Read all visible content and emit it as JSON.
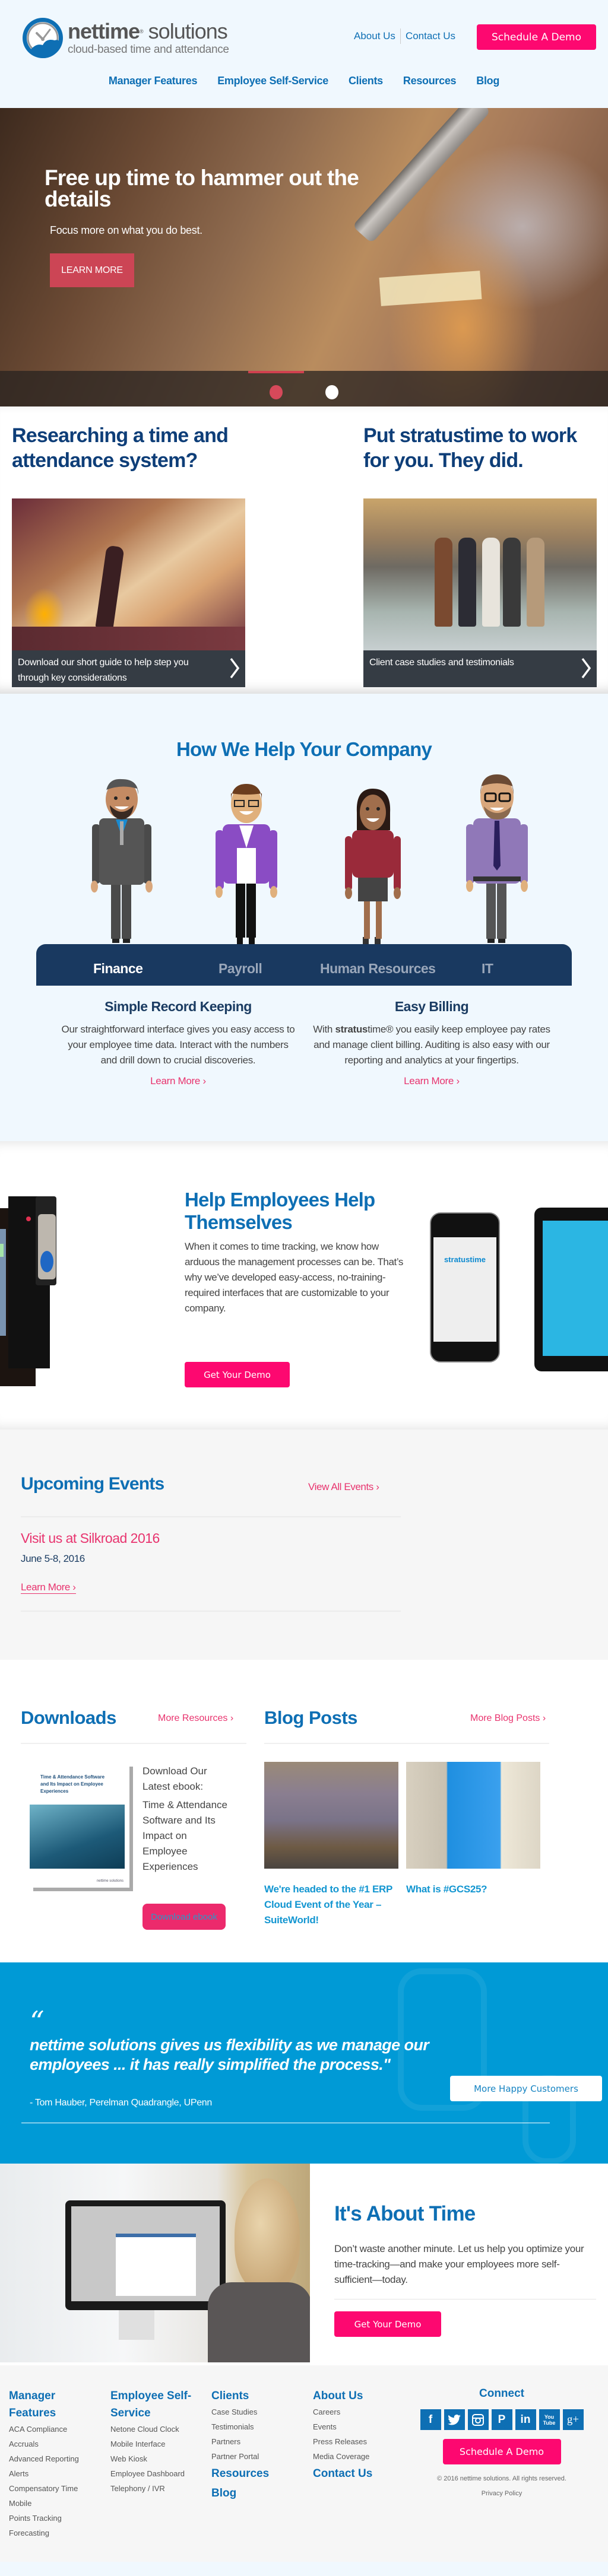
{
  "header": {
    "logo_name_bold": "nettime",
    "logo_reg": "®",
    "logo_name_light": " solutions",
    "logo_tagline": "cloud-based time and attendance",
    "top_links": [
      "About Us",
      "Contact Us"
    ],
    "demo_button": "Schedule A Demo",
    "nav": [
      "Manager Features",
      "Employee Self-Service",
      "Clients",
      "Resources",
      "Blog"
    ]
  },
  "hero": {
    "title": "Free up time to hammer out the details",
    "subtitle": "Focus more on what you do best.",
    "button": "LEARN MORE",
    "slides_total": 2,
    "active_slide": 1
  },
  "research": {
    "left": {
      "title": "Researching a time and attendance system?",
      "caption": "Download our short guide to help step you through key considerations"
    },
    "right": {
      "title": "Put stratustime to work for you. They did.",
      "caption": "Client case studies and testimonials"
    }
  },
  "help": {
    "title": "How We Help Your Company",
    "tabs": [
      "Finance",
      "Payroll",
      "Human Resources",
      "IT"
    ],
    "active_tab": "Finance",
    "features": [
      {
        "title": "Simple Record Keeping",
        "body": "Our straightforward interface gives you easy access to your employee time data. Interact with the numbers and drill down to crucial discoveries.",
        "link": "Learn More ›"
      },
      {
        "title": "Easy Billing",
        "body_bold": "stratus",
        "body_pre": "With ",
        "body_post": "time® you easily keep employee pay rates and manage client billing. Auditing is also easy with our reporting and analytics at your fingertips.",
        "link": "Learn More ›"
      }
    ]
  },
  "employees": {
    "title": "Help Employees Help Themselves",
    "body": "When it comes to time tracking, we know how arduous the management processes can be. That’s why we’ve developed easy-access, no-training-required interfaces that are customizable to your company.",
    "button": "Get Your Demo",
    "phone_brand": "stratustime"
  },
  "events": {
    "title": "Upcoming Events",
    "view_all": "View All Events ›",
    "items": [
      {
        "name": "Visit us at Silkroad 2016",
        "date": "June 5-8, 2016",
        "link": "Learn More ›"
      }
    ]
  },
  "downloads": {
    "title": "Downloads",
    "more": "More Resources ›",
    "ebook_cover_title": "Time & Attendance Software and Its Impact on Employee Experiences",
    "ebook_cover_logo": "nettime solutions",
    "intro": "Download Our Latest ebook:",
    "ebook_title": "Time & Attendance Software and Its Impact on Employee Experiences",
    "button": "Download ebook"
  },
  "blog": {
    "title": "Blog Posts",
    "more": "More Blog Posts ›",
    "posts": [
      {
        "title": "We're headed to the #1 ERP Cloud Event of the Year – SuiteWorld!"
      },
      {
        "title": "What is #GCS25?"
      }
    ]
  },
  "testimonial": {
    "quote_mark": "“",
    "quote": "nettime solutions gives us flexibility as we manage our employees ... it has really simplified the process.\"",
    "author": "- Tom Hauber, Perelman Quadrangle, UPenn",
    "button": "More Happy Customers"
  },
  "about_time": {
    "title": "It's About Time",
    "body": "Don’t waste another minute. Let us help you optimize your time-tracking—and make your employees more self-sufficient—today.",
    "button": "Get Your Demo"
  },
  "footer": {
    "columns": [
      {
        "heading": "Manager Features",
        "links": [
          "ACA Compliance",
          "Accruals",
          "Advanced Reporting",
          "Alerts",
          "Compensatory Time",
          "Mobile",
          "Points Tracking",
          "Forecasting"
        ]
      },
      {
        "heading": "Employee Self-Service",
        "links": [
          "Netone Cloud Clock",
          "Mobile Interface",
          "Web Kiosk",
          "Employee Dashboard",
          "Telephony / IVR"
        ]
      },
      {
        "heading": "Clients",
        "links": [
          "Case Studies",
          "Testimonials",
          "Partners",
          "Partner Portal"
        ],
        "extra_headings": [
          "Resources",
          "Blog"
        ]
      },
      {
        "heading": "About Us",
        "links": [
          "Careers",
          "Events",
          "Press Releases",
          "Media Coverage"
        ],
        "extra_headings": [
          "Contact Us"
        ]
      }
    ],
    "connect_title": "Connect",
    "socials": [
      {
        "name": "facebook",
        "glyph": "f"
      },
      {
        "name": "twitter",
        "glyph": "t"
      },
      {
        "name": "instagram",
        "glyph": "◙"
      },
      {
        "name": "pinterest",
        "glyph": "P"
      },
      {
        "name": "linkedin",
        "glyph": "in"
      },
      {
        "name": "youtube",
        "glyph": "▶"
      },
      {
        "name": "google-plus",
        "glyph": "g+"
      }
    ],
    "demo_button": "Schedule A Demo",
    "copyright": "© 2016 nettime solutions. All rights reserved.",
    "privacy": "Privacy Policy"
  },
  "colors": {
    "brand_blue": "#0e6fb4",
    "navy": "#193960",
    "pink_cta": "#fd0870",
    "pink_link": "#e8336e",
    "testimonial_bg": "#009ad6",
    "page_bg": "#f0f8fe"
  }
}
